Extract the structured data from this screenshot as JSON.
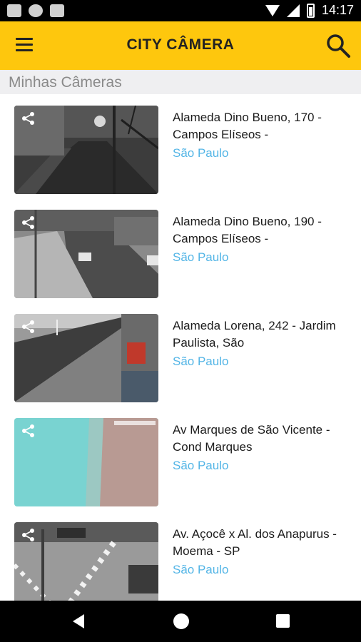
{
  "status_bar": {
    "time": "14:17",
    "icons": [
      "gmail-icon",
      "circle-icon",
      "sd-card-icon",
      "wifi-icon",
      "signal-icon",
      "battery-icon"
    ]
  },
  "app_bar": {
    "title": "CITY CÂMERA",
    "menu_icon": "hamburger-menu-icon",
    "search_icon": "search-icon",
    "color": "#fec70d"
  },
  "section": {
    "title": "Minhas Câmeras"
  },
  "cameras": [
    {
      "title": "Alameda Dino Bueno, 170 - Campos Elíseos -",
      "city": "São Paulo"
    },
    {
      "title": "Alameda Dino Bueno, 190 - Campos Elíseos -",
      "city": "São Paulo"
    },
    {
      "title": "Alameda Lorena, 242 - Jardim Paulista, São",
      "city": "São Paulo"
    },
    {
      "title": "Av Marques de São Vicente - Cond Marques",
      "city": "São Paulo"
    },
    {
      "title": "Av. Açocê x Al. dos Anapurus - Moema - SP",
      "city": "São Paulo"
    }
  ],
  "colors": {
    "city_link": "#53b5e6",
    "section_bg": "#efeff1"
  },
  "nav_bar": {
    "icons": [
      "back-icon",
      "home-icon",
      "recents-icon"
    ]
  }
}
